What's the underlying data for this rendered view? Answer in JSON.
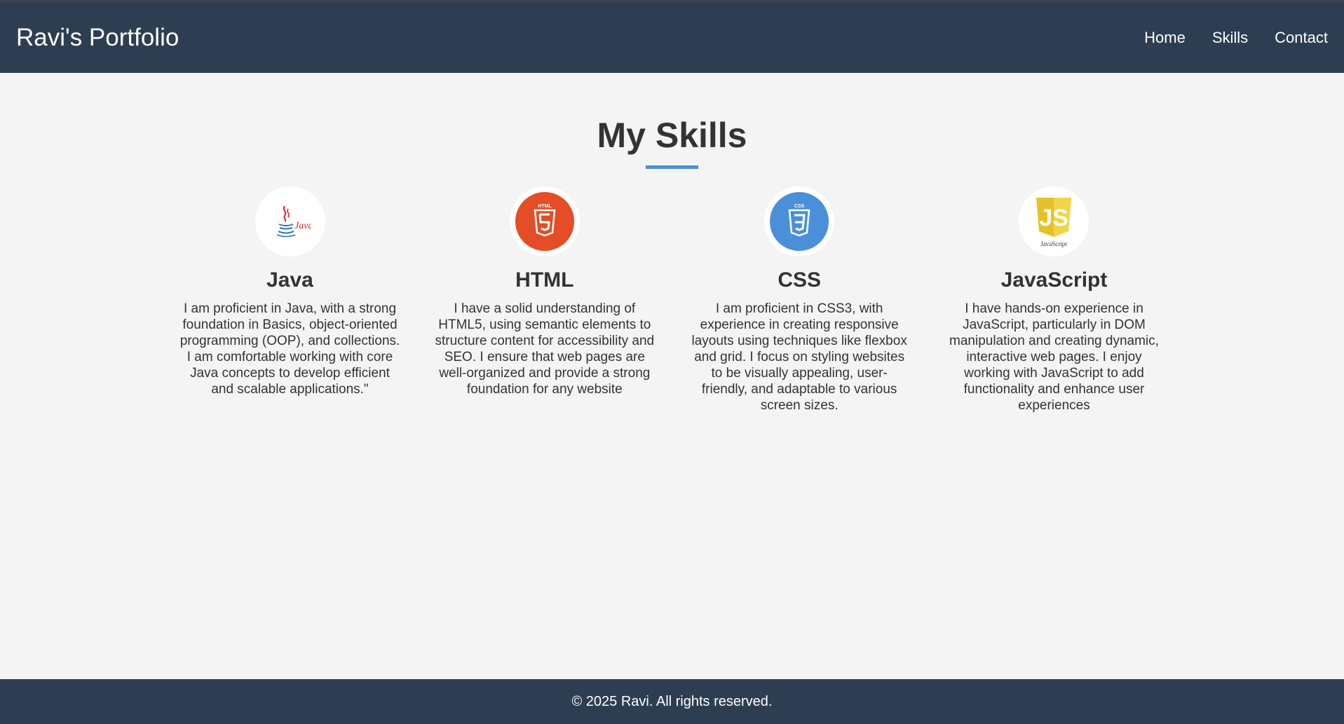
{
  "header": {
    "brand": "Ravi's Portfolio",
    "nav": [
      "Home",
      "Skills",
      "Contact"
    ]
  },
  "skills_section": {
    "title": "My Skills",
    "items": [
      {
        "name": "Java",
        "icon": "java-logo-icon",
        "logo_text": "Java",
        "description": "I am proficient in Java, with a strong foundation in Basics, object-oriented programming (OOP), and collections. I am comfortable working with core Java concepts to develop efficient and scalable applications.\""
      },
      {
        "name": "HTML",
        "icon": "html5-logo-icon",
        "logo_text": "HTML",
        "description": "I have a solid understanding of HTML5, using semantic elements to structure content for accessibility and SEO. I ensure that web pages are well-organized and provide a strong foundation for any website"
      },
      {
        "name": "CSS",
        "icon": "css3-logo-icon",
        "logo_text": "CSS",
        "description": "I am proficient in CSS3, with experience in creating responsive layouts using techniques like flexbox and grid. I focus on styling websites to be visually appealing, user-friendly, and adaptable to various screen sizes."
      },
      {
        "name": "JavaScript",
        "icon": "javascript-logo-icon",
        "logo_text": "JavaScript",
        "description": "I have hands-on experience in JavaScript, particularly in DOM manipulation and creating dynamic, interactive web pages. I enjoy working with JavaScript to add functionality and enhance user experiences"
      }
    ]
  },
  "footer": {
    "text": "© 2025 Ravi. All rights reserved."
  },
  "colors": {
    "header_bg": "#2e3e52",
    "page_bg": "#f4f4f4",
    "accent": "#4a90d9",
    "html_orange": "#e44d26",
    "css_blue": "#4a90d9",
    "js_yellow": "#e8c12a",
    "java_red": "#e11f21"
  }
}
